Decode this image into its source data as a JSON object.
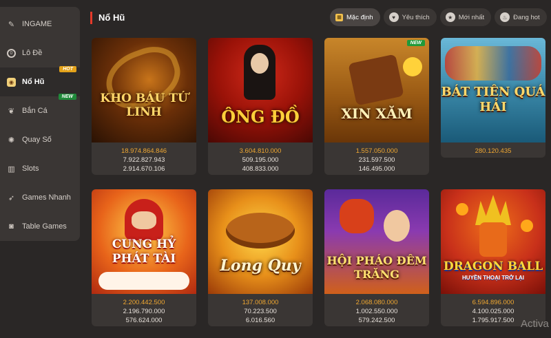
{
  "sidebar": {
    "items": [
      {
        "label": "INGAME",
        "icon": "ingame-icon"
      },
      {
        "label": "Lô Đề",
        "icon": "lode-icon"
      },
      {
        "label": "Nổ Hũ",
        "icon": "nohu-icon",
        "badge": "HOT"
      },
      {
        "label": "Bắn Cá",
        "icon": "fish-icon",
        "badge": "NEW"
      },
      {
        "label": "Quay Số",
        "icon": "lottery-icon"
      },
      {
        "label": "Slots",
        "icon": "slots-icon"
      },
      {
        "label": "Games Nhanh",
        "icon": "rocket-icon"
      },
      {
        "label": "Table Games",
        "icon": "table-games-icon"
      }
    ]
  },
  "header": {
    "title": "Nổ Hũ",
    "filters": [
      {
        "label": "Mặc định",
        "icon": "grid-icon",
        "active": true
      },
      {
        "label": "Yêu thích",
        "icon": "heart-icon"
      },
      {
        "label": "Mới nhất",
        "icon": "star-icon"
      },
      {
        "label": "Đang hot",
        "icon": "flame-icon"
      }
    ]
  },
  "games": [
    {
      "title": "KHO BÁU TỨ LINH",
      "jackpots": [
        "18.974.864.846",
        "7.922.827.943",
        "2.914.670.106"
      ]
    },
    {
      "title": "ÔNG ĐỒ",
      "jackpots": [
        "3.604.810.000",
        "509.195.000",
        "408.833.000"
      ]
    },
    {
      "title": "XIN XĂM",
      "badge": "NEW",
      "jackpots": [
        "1.557.050.000",
        "231.597.500",
        "146.495.000"
      ]
    },
    {
      "title": "BÁT TIÊN QUÁ HẢI",
      "jackpots": [
        "280.120.435"
      ]
    },
    {
      "title": "CUNG HỶ PHÁT TÀI",
      "jackpots": [
        "2.200.442.500",
        "2.196.790.000",
        "576.624.000"
      ]
    },
    {
      "title": "Long Quy",
      "jackpots": [
        "137.008.000",
        "70.223.500",
        "6.016.560"
      ]
    },
    {
      "title": "HỘI PHÁO ĐÊM TRĂNG",
      "jackpots": [
        "2.068.080.000",
        "1.002.550.000",
        "579.242.500"
      ]
    },
    {
      "title": "DRAGON BALL",
      "subtitle": "HUYỀN THOẠI TRỞ LẠI",
      "jackpots": [
        "6.594.896.000",
        "4.100.025.000",
        "1.795.917.500"
      ]
    }
  ],
  "overlay": {
    "activate": "Activa"
  },
  "colors": {
    "accent": "#f0a832",
    "title_bar": "#e63a2a",
    "background": "#2a2726"
  }
}
